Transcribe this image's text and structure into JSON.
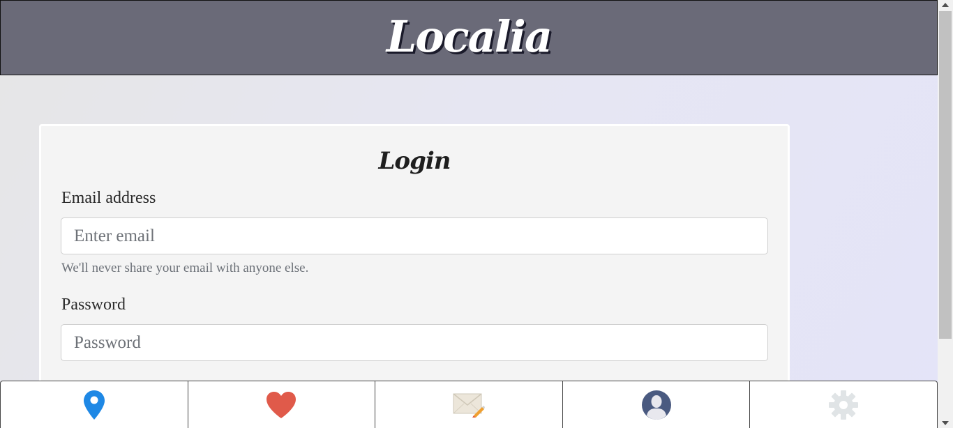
{
  "header": {
    "logo_text": "Localia"
  },
  "login": {
    "title": "Login",
    "email_label": "Email address",
    "email_placeholder": "Enter email",
    "email_value": "",
    "email_help": "We'll never share your email with anyone else.",
    "password_label": "Password",
    "password_placeholder": "Password",
    "password_value": ""
  },
  "navbar": {
    "items": [
      {
        "icon": "map-pin-icon",
        "color": "#1e88e5"
      },
      {
        "icon": "heart-icon",
        "color": "#e05a4a"
      },
      {
        "icon": "envelope-pencil-icon",
        "color": "#e8e0d0"
      },
      {
        "icon": "user-avatar-icon",
        "color": "#4a5a80"
      },
      {
        "icon": "gear-icon",
        "color": "#e0e4e6"
      }
    ]
  },
  "colors": {
    "header_bg": "#6a6a78",
    "card_bg": "#f4f4f4"
  }
}
